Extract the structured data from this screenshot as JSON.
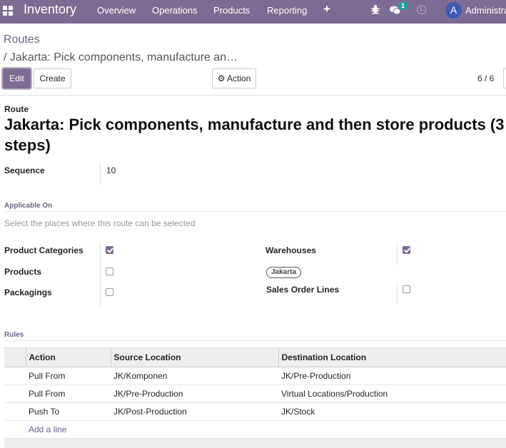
{
  "navbar": {
    "app_name": "Inventory",
    "menu": [
      "Overview",
      "Operations",
      "Products",
      "Reporting"
    ],
    "plus": "+",
    "chat_count": "1",
    "avatar_letter": "A",
    "user": "Administrator",
    "color": "#7c6b92"
  },
  "breadcrumb": {
    "root": "Routes",
    "current": "/ Jakarta: Pick components, manufacture an…"
  },
  "buttons": {
    "edit": "Edit",
    "create": "Create",
    "action": "⚙ Action"
  },
  "pager": "6 / 6",
  "form": {
    "route_label": "Route",
    "title": "Jakarta: Pick components, manufacture and then store products (3 steps)",
    "sequence_label": "Sequence",
    "sequence_value": "10",
    "applicable_on_title": "Applicable On",
    "applicable_on_hint": "Select the places where this route can be selected",
    "product_categories_label": "Product Categories",
    "product_categories_checked": true,
    "products_label": "Products",
    "products_checked": false,
    "packagings_label": "Packagings",
    "packagings_checked": false,
    "warehouses_label": "Warehouses",
    "warehouses_checked": true,
    "warehouse_tag": "Jakarta",
    "sales_order_lines_label": "Sales Order Lines",
    "sales_order_lines_checked": false
  },
  "rules": {
    "title": "Rules",
    "columns": [
      "Action",
      "Source Location",
      "Destination Location"
    ],
    "rows": [
      {
        "action": "Pull From",
        "source": "JK/Komponen",
        "destination": "JK/Pre-Production"
      },
      {
        "action": "Pull From",
        "source": "JK/Pre-Production",
        "destination": "Virtual Locations/Production"
      },
      {
        "action": "Push To",
        "source": "JK/Post-Production",
        "destination": "JK/Stock"
      }
    ],
    "add_line": "Add a line"
  }
}
